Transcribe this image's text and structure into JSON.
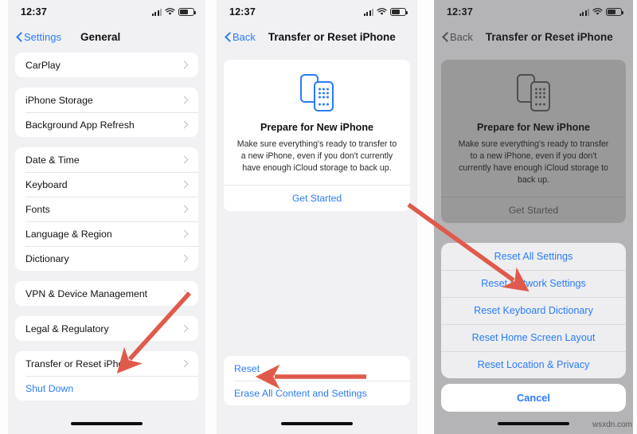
{
  "meta": {
    "watermark": "wsxdn.com",
    "accent_blue": "#2a7cf7",
    "arrow_red": "#e05a4b",
    "panel_bg": "#f1f1f4",
    "card_bg": "#ffffff"
  },
  "status_bar": {
    "time": "12:37",
    "signal_icon": "cellular-signal-icon",
    "wifi_icon": "wifi-icon",
    "battery_icon": "battery-icon"
  },
  "panel1": {
    "nav": {
      "back_label": "Settings",
      "title": "General"
    },
    "groups": [
      {
        "items": [
          {
            "label": "CarPlay",
            "type": "chevron"
          }
        ]
      },
      {
        "items": [
          {
            "label": "iPhone Storage",
            "type": "chevron"
          },
          {
            "label": "Background App Refresh",
            "type": "chevron"
          }
        ]
      },
      {
        "items": [
          {
            "label": "Date & Time",
            "type": "chevron"
          },
          {
            "label": "Keyboard",
            "type": "chevron"
          },
          {
            "label": "Fonts",
            "type": "chevron"
          },
          {
            "label": "Language & Region",
            "type": "chevron"
          },
          {
            "label": "Dictionary",
            "type": "chevron"
          }
        ]
      },
      {
        "items": [
          {
            "label": "VPN & Device Management",
            "type": "chevron"
          }
        ]
      },
      {
        "items": [
          {
            "label": "Legal & Regulatory",
            "type": "chevron"
          }
        ]
      },
      {
        "items": [
          {
            "label": "Transfer or Reset iPhone",
            "type": "chevron"
          },
          {
            "label": "Shut Down",
            "type": "link"
          }
        ]
      }
    ]
  },
  "panel2": {
    "nav": {
      "back_label": "Back",
      "title": "Transfer or Reset iPhone"
    },
    "prepare": {
      "icon": "two-iphones-icon",
      "title": "Prepare for New iPhone",
      "description": "Make sure everything's ready to transfer to a new iPhone, even if you don't currently have enough iCloud storage to back up.",
      "action_label": "Get Started"
    },
    "bottom_items": [
      {
        "label": "Reset"
      },
      {
        "label": "Erase All Content and Settings"
      }
    ]
  },
  "panel3": {
    "nav": {
      "back_label": "Back",
      "title": "Transfer or Reset iPhone"
    },
    "prepare": {
      "icon": "two-iphones-icon",
      "title": "Prepare for New iPhone",
      "description": "Make sure everything's ready to transfer to a new iPhone, even if you don't currently have enough iCloud storage to back up.",
      "action_label": "Get Started"
    },
    "action_sheet": {
      "options": [
        {
          "label": "Reset All Settings"
        },
        {
          "label": "Reset Network Settings"
        },
        {
          "label": "Reset Keyboard Dictionary"
        },
        {
          "label": "Reset Home Screen Layout"
        },
        {
          "label": "Reset Location & Privacy"
        }
      ],
      "cancel_label": "Cancel"
    }
  },
  "annotations": [
    {
      "name": "arrow-to-transfer-or-reset",
      "target": "Transfer or Reset iPhone"
    },
    {
      "name": "arrow-to-reset",
      "target": "Reset"
    },
    {
      "name": "arrow-to-reset-network-settings",
      "target": "Reset Network Settings"
    }
  ]
}
